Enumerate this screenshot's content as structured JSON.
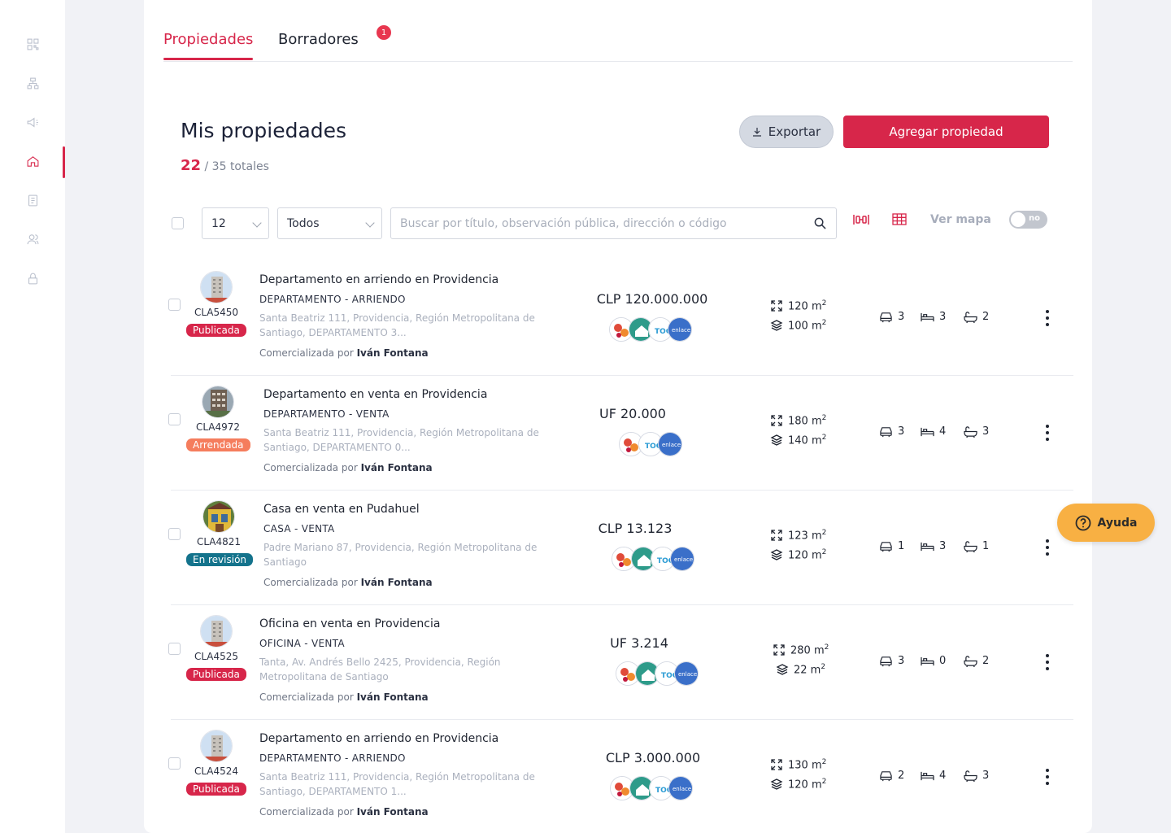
{
  "tabs": {
    "properties": "Propiedades",
    "drafts": "Borradores",
    "drafts_badge": "1"
  },
  "header": {
    "title": "Mis propiedades",
    "count": "22",
    "total": "/ 35 totales"
  },
  "actions": {
    "export": "Exportar",
    "add": "Agregar propiedad"
  },
  "filters": {
    "per_page": "12",
    "status": "Todos",
    "search_placeholder": "Buscar por título, observación pública, dirección o código",
    "map_label": "Ver mapa",
    "map_toggle": "no"
  },
  "help": {
    "label": "Ayuda"
  },
  "colors": {
    "accent": "#d7264a",
    "published": "#d7264a",
    "rented": "#f57d5d",
    "review": "#14738c",
    "help": "#f8b043"
  },
  "properties": [
    {
      "code": "CLA5450",
      "status": "Publicada",
      "title": "Departamento en arriendo en Providencia",
      "type": "DEPARTAMENTO - ARRIENDO",
      "address": "Santa Beatriz 111, Providencia, Región Metropolitana de Santiago, DEPARTAMENTO 3...",
      "by_label": "Comercializada por",
      "agent": "Iván Fontana",
      "price": "CLP 120.000.000",
      "area_total": "120 m",
      "area_built": "100 m",
      "parking": "3",
      "bedrooms": "3",
      "bathrooms": "2"
    },
    {
      "code": "CLA4972",
      "status": "Arrendada",
      "title": "Departamento en venta en Providencia",
      "type": "DEPARTAMENTO - VENTA",
      "address": "Santa Beatriz 111, Providencia, Región Metropolitana de Santiago, DEPARTAMENTO 0...",
      "by_label": "Comercializada por",
      "agent": "Iván Fontana",
      "price": "UF 20.000",
      "area_total": "180 m",
      "area_built": "140 m",
      "parking": "3",
      "bedrooms": "4",
      "bathrooms": "3"
    },
    {
      "code": "CLA4821",
      "status": "En revisión",
      "title": "Casa en venta en Pudahuel",
      "type": "CASA - VENTA",
      "address": "Padre Mariano 87, Providencia, Región Metropolitana de Santiago",
      "by_label": "Comercializada por",
      "agent": "Iván Fontana",
      "price": "CLP 13.123",
      "area_total": "123 m",
      "area_built": "120 m",
      "parking": "1",
      "bedrooms": "3",
      "bathrooms": "1"
    },
    {
      "code": "CLA4525",
      "status": "Publicada",
      "title": "Oficina en venta en Providencia",
      "type": "OFICINA - VENTA",
      "address": "Tanta, Av. Andrés Bello 2425, Providencia, Región Metropolitana de Santiago",
      "by_label": "Comercializada por",
      "agent": "Iván Fontana",
      "price": "UF 3.214",
      "area_total": "280 m",
      "area_built": "22 m",
      "parking": "3",
      "bedrooms": "0",
      "bathrooms": "2"
    },
    {
      "code": "CLA4524",
      "status": "Publicada",
      "title": "Departamento en arriendo en Providencia",
      "type": "DEPARTAMENTO - ARRIENDO",
      "address": "Santa Beatriz 111, Providencia, Región Metropolitana de Santiago, DEPARTAMENTO 1...",
      "by_label": "Comercializada por",
      "agent": "Iván Fontana",
      "price": "CLP 3.000.000",
      "area_total": "130 m",
      "area_built": "120 m",
      "parking": "2",
      "bedrooms": "4",
      "bathrooms": "3"
    }
  ],
  "portal_logos": {
    "enlace": "enlace",
    "toc": "TOC"
  }
}
